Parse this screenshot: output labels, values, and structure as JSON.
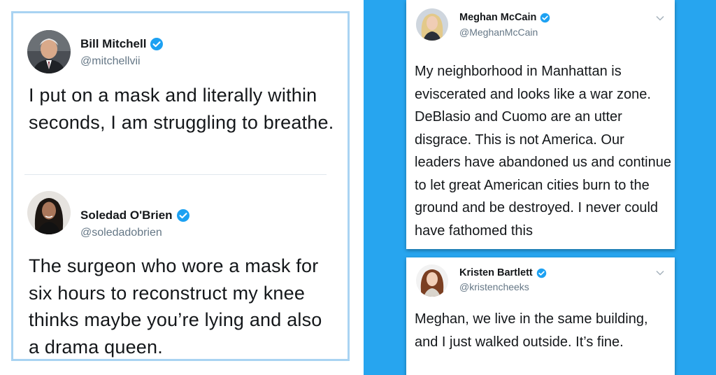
{
  "left_tweets": [
    {
      "name": "Bill Mitchell",
      "handle": "@mitchellvii",
      "text": "I put on a mask and literally within seconds, I am struggling to breathe.",
      "avatar": "man-portrait-avatar"
    },
    {
      "name": "Soledad O'Brien",
      "handle": "@soledadobrien",
      "text": "The surgeon who wore a mask for six hours to reconstruct my knee thinks maybe you’re lying and also a drama queen.",
      "avatar": "woman-portrait-avatar"
    }
  ],
  "right_tweets": [
    {
      "name": "Meghan McCain",
      "handle": "@MeghanMcCain",
      "text": "My neighborhood in Manhattan is eviscerated and looks like a war zone. DeBlasio and Cuomo are an utter disgrace. This is not America. Our leaders have abandoned us and continue to let great American cities burn to the ground and be destroyed. I never could have fathomed this",
      "avatar": "woman-portrait-avatar"
    },
    {
      "name": "Kristen Bartlett",
      "handle": "@kristencheeks",
      "text": "Meghan, we live in the same building, and I just walked outside. It’s fine.",
      "avatar": "woman-portrait-avatar"
    }
  ],
  "icons": {
    "verified": "verified-badge-icon",
    "chevron": "chevron-down-icon"
  },
  "colors": {
    "verified_blue": "#1da1f2",
    "right_background": "#27a5ef",
    "left_border": "#a9d3f2",
    "handle_gray": "#657786",
    "text": "#14171a"
  }
}
